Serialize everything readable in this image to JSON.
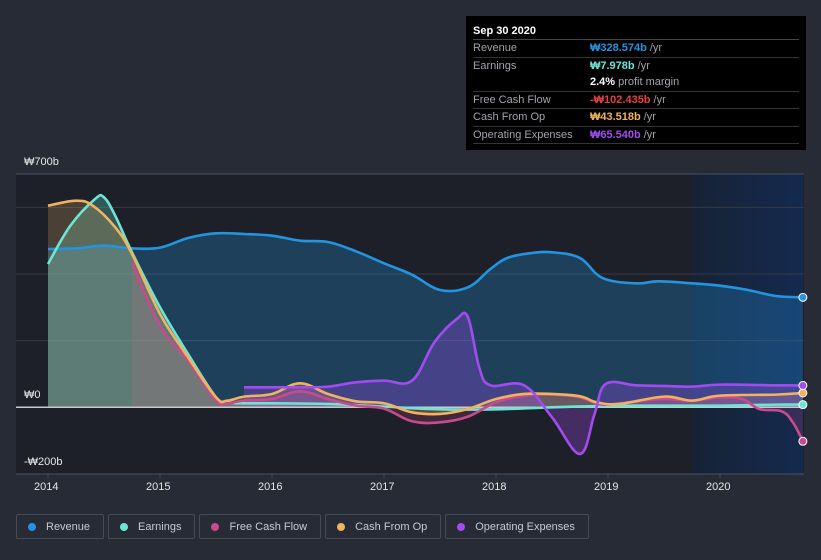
{
  "tooltip": {
    "date": "Sep 30 2020",
    "rows": [
      {
        "label": "Revenue",
        "value": "₩328.574b",
        "unit": "/yr",
        "color": "#2394df"
      },
      {
        "label": "Earnings",
        "value": "₩7.978b",
        "unit": "/yr",
        "color": "#6ce5d4"
      },
      {
        "label": "",
        "value": "2.4%",
        "unit": "profit margin",
        "color": "#ffffff"
      },
      {
        "label": "Free Cash Flow",
        "value": "-₩102.435b",
        "unit": "/yr",
        "color": "#e64141"
      },
      {
        "label": "Cash From Op",
        "value": "₩43.518b",
        "unit": "/yr",
        "color": "#f0b35e"
      },
      {
        "label": "Operating Expenses",
        "value": "₩65.540b",
        "unit": "/yr",
        "color": "#a24cf0"
      }
    ]
  },
  "legend": [
    {
      "label": "Revenue",
      "color": "#2394df"
    },
    {
      "label": "Earnings",
      "color": "#6ce5d4"
    },
    {
      "label": "Free Cash Flow",
      "color": "#c94a8d"
    },
    {
      "label": "Cash From Op",
      "color": "#f0b35e"
    },
    {
      "label": "Operating Expenses",
      "color": "#a24cf0"
    }
  ],
  "chart_data": {
    "type": "area",
    "title": "",
    "xlabel": "",
    "ylabel": "",
    "units": "KRW billions",
    "xlim": [
      2013.7,
      2020.74
    ],
    "ylim": [
      -200,
      700
    ],
    "y_ticks": [
      {
        "value": 700,
        "label": "₩700b"
      },
      {
        "value": 0,
        "label": "₩0"
      },
      {
        "value": -200,
        "label": "-₩200b"
      }
    ],
    "gridlines": [
      600,
      400,
      200
    ],
    "x_ticks": [
      {
        "value": 2014,
        "label": "2014"
      },
      {
        "value": 2015,
        "label": "2015"
      },
      {
        "value": 2016,
        "label": "2016"
      },
      {
        "value": 2017,
        "label": "2017"
      },
      {
        "value": 2018,
        "label": "2018"
      },
      {
        "value": 2019,
        "label": "2019"
      },
      {
        "value": 2020,
        "label": "2020"
      }
    ],
    "forecast_region_start": 2019.75,
    "legend_position": "bottom-left",
    "series": [
      {
        "name": "Revenue",
        "color": "#2394df",
        "points": [
          [
            2014.0,
            475
          ],
          [
            2014.25,
            477
          ],
          [
            2014.5,
            485
          ],
          [
            2014.75,
            477
          ],
          [
            2015.0,
            479
          ],
          [
            2015.25,
            508
          ],
          [
            2015.5,
            522
          ],
          [
            2015.75,
            520
          ],
          [
            2016.0,
            515
          ],
          [
            2016.25,
            500
          ],
          [
            2016.5,
            496
          ],
          [
            2016.75,
            468
          ],
          [
            2017.0,
            432
          ],
          [
            2017.25,
            398
          ],
          [
            2017.5,
            352
          ],
          [
            2017.75,
            360
          ],
          [
            2017.95,
            415
          ],
          [
            2018.1,
            448
          ],
          [
            2018.3,
            462
          ],
          [
            2018.5,
            465
          ],
          [
            2018.75,
            448
          ],
          [
            2018.95,
            388
          ],
          [
            2019.25,
            372
          ],
          [
            2019.45,
            378
          ],
          [
            2019.75,
            372
          ],
          [
            2020.0,
            365
          ],
          [
            2020.25,
            352
          ],
          [
            2020.5,
            334
          ],
          [
            2020.74,
            330
          ]
        ]
      },
      {
        "name": "Earnings",
        "color": "#6ce5d4",
        "points": [
          [
            2014.0,
            430
          ],
          [
            2014.2,
            545
          ],
          [
            2014.42,
            625
          ],
          [
            2014.5,
            630
          ],
          [
            2014.6,
            575
          ],
          [
            2014.75,
            465
          ],
          [
            2015.0,
            300
          ],
          [
            2015.25,
            160
          ],
          [
            2015.5,
            30
          ],
          [
            2015.6,
            15
          ],
          [
            2015.75,
            12
          ],
          [
            2016.0,
            12
          ],
          [
            2016.5,
            10
          ],
          [
            2017.0,
            2
          ],
          [
            2017.5,
            -6
          ],
          [
            2018.0,
            -6
          ],
          [
            2018.5,
            0
          ],
          [
            2019.0,
            4
          ],
          [
            2019.5,
            5
          ],
          [
            2020.0,
            5
          ],
          [
            2020.5,
            8
          ],
          [
            2020.74,
            8
          ]
        ]
      },
      {
        "name": "Free Cash Flow",
        "color": "#c94a8d",
        "points": [
          [
            2014.75,
            435
          ],
          [
            2015.0,
            245
          ],
          [
            2015.25,
            140
          ],
          [
            2015.5,
            20
          ],
          [
            2015.6,
            12
          ],
          [
            2015.75,
            20
          ],
          [
            2016.0,
            25
          ],
          [
            2016.25,
            48
          ],
          [
            2016.5,
            25
          ],
          [
            2016.75,
            5
          ],
          [
            2017.0,
            -4
          ],
          [
            2017.25,
            -42
          ],
          [
            2017.5,
            -45
          ],
          [
            2017.75,
            -28
          ],
          [
            2018.0,
            15
          ],
          [
            2018.25,
            35
          ],
          [
            2018.5,
            38
          ],
          [
            2018.75,
            30
          ],
          [
            2018.95,
            8
          ],
          [
            2019.25,
            18
          ],
          [
            2019.5,
            25
          ],
          [
            2019.75,
            20
          ],
          [
            2020.0,
            30
          ],
          [
            2020.2,
            25
          ],
          [
            2020.35,
            -5
          ],
          [
            2020.55,
            -12
          ],
          [
            2020.65,
            -45
          ],
          [
            2020.74,
            -102
          ]
        ]
      },
      {
        "name": "Cash From Op",
        "color": "#f0b35e",
        "points": [
          [
            2014.0,
            605
          ],
          [
            2014.25,
            620
          ],
          [
            2014.4,
            605
          ],
          [
            2014.6,
            540
          ],
          [
            2014.75,
            460
          ],
          [
            2015.0,
            280
          ],
          [
            2015.25,
            150
          ],
          [
            2015.5,
            30
          ],
          [
            2015.6,
            20
          ],
          [
            2015.75,
            32
          ],
          [
            2016.0,
            40
          ],
          [
            2016.25,
            72
          ],
          [
            2016.5,
            40
          ],
          [
            2016.75,
            18
          ],
          [
            2017.0,
            12
          ],
          [
            2017.25,
            -15
          ],
          [
            2017.5,
            -20
          ],
          [
            2017.75,
            -5
          ],
          [
            2018.0,
            25
          ],
          [
            2018.25,
            40
          ],
          [
            2018.5,
            40
          ],
          [
            2018.75,
            33
          ],
          [
            2018.9,
            15
          ],
          [
            2019.1,
            10
          ],
          [
            2019.5,
            32
          ],
          [
            2019.75,
            20
          ],
          [
            2020.0,
            35
          ],
          [
            2020.5,
            38
          ],
          [
            2020.74,
            43
          ]
        ]
      },
      {
        "name": "Operating Expenses",
        "color": "#a24cf0",
        "points": [
          [
            2015.75,
            60
          ],
          [
            2016.0,
            60
          ],
          [
            2016.25,
            60
          ],
          [
            2016.5,
            62
          ],
          [
            2016.75,
            75
          ],
          [
            2017.0,
            80
          ],
          [
            2017.25,
            80
          ],
          [
            2017.45,
            195
          ],
          [
            2017.65,
            265
          ],
          [
            2017.75,
            270
          ],
          [
            2017.85,
            120
          ],
          [
            2017.95,
            66
          ],
          [
            2018.25,
            66
          ],
          [
            2018.5,
            -30
          ],
          [
            2018.75,
            -140
          ],
          [
            2018.88,
            -20
          ],
          [
            2018.98,
            70
          ],
          [
            2019.25,
            66
          ],
          [
            2019.5,
            64
          ],
          [
            2019.75,
            62
          ],
          [
            2020.0,
            68
          ],
          [
            2020.5,
            66
          ],
          [
            2020.74,
            65.5
          ]
        ]
      }
    ]
  }
}
